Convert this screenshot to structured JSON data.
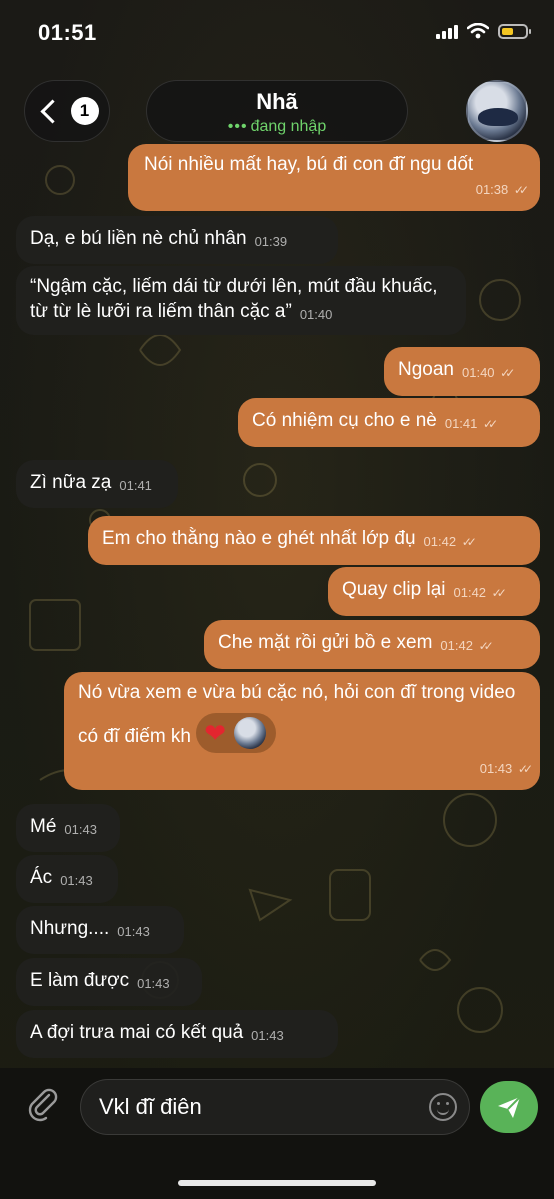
{
  "status_bar": {
    "time": "01:51"
  },
  "header": {
    "back_badge": "1",
    "contact_name": "Nhã",
    "contact_status": "đang nhập",
    "status_dots": "•••"
  },
  "messages": [
    {
      "dir": "out",
      "text": "Nói nhiều mất hay, bú đi con đĩ ngu dốt",
      "time": "01:38"
    },
    {
      "dir": "in",
      "text": "Dạ, e bú liền nè chủ nhân",
      "time": "01:39"
    },
    {
      "dir": "in",
      "text": "“Ngậm cặc, liếm dái từ dưới lên, mút đầu khuấc, từ từ lè lưỡi ra liếm thân cặc a”",
      "time": "01:40"
    },
    {
      "dir": "out",
      "text": "Ngoan",
      "time": "01:40"
    },
    {
      "dir": "out",
      "text": "Có nhiệm cụ cho e nè",
      "time": "01:41"
    },
    {
      "dir": "in",
      "text": "Zì nữa zạ",
      "time": "01:41"
    },
    {
      "dir": "out",
      "text": "Em cho thằng nào e ghét nhất lớp đụ",
      "time": "01:42"
    },
    {
      "dir": "out",
      "text": "Quay clip lại",
      "time": "01:42"
    },
    {
      "dir": "out",
      "text": "Che mặt rồi gửi bồ e xem",
      "time": "01:42"
    },
    {
      "dir": "out",
      "text": "Nó vừa xem e vừa bú cặc nó, hỏi con đĩ trong video có đĩ điếm kh",
      "time": "01:43",
      "reaction": "heart"
    },
    {
      "dir": "in",
      "text": "Mé",
      "time": "01:43"
    },
    {
      "dir": "in",
      "text": "Ác",
      "time": "01:43"
    },
    {
      "dir": "in",
      "text": "Nhưng....",
      "time": "01:43"
    },
    {
      "dir": "in",
      "text": "E làm được",
      "time": "01:43"
    },
    {
      "dir": "in",
      "text": "A đợi trưa mai có kết quả",
      "time": "01:43"
    }
  ],
  "composer": {
    "value": "Vkl đĩ điên"
  },
  "colors": {
    "outgoing": "#c9783f",
    "incoming": "#21211e",
    "send": "#59b358",
    "online": "#6fd36b"
  }
}
